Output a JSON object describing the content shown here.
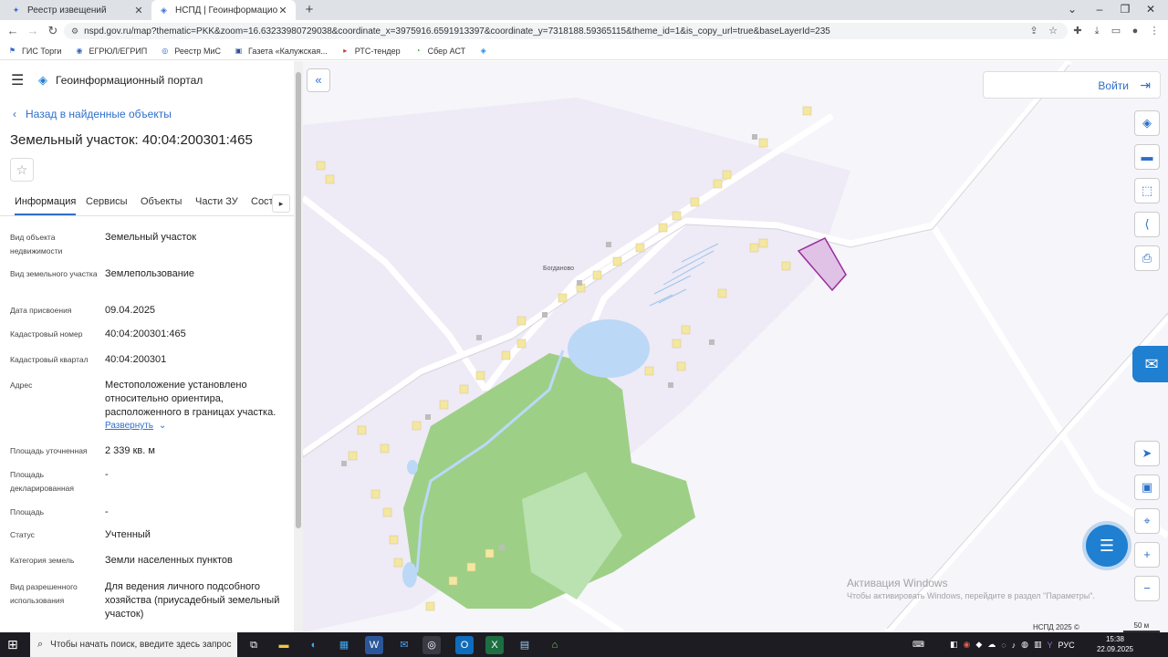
{
  "browser": {
    "tabs": [
      {
        "title": "Реестр извещений",
        "active": false
      },
      {
        "title": "НСПД | Геоинформационный п",
        "active": true
      }
    ],
    "url": "nspd.gov.ru/map?thematic=PKK&zoom=16.63233980729038&coordinate_x=3975916.6591913397&coordinate_y=7318188.59365115&theme_id=1&is_copy_url=true&baseLayerId=235",
    "bookmarks": [
      "ГИС Торги",
      "ЕГРЮЛ/ЕГРИП",
      "Реестр МиС",
      "Газета «Калужская...",
      "РТС-тендер",
      "Сбер АСТ"
    ]
  },
  "portal": {
    "title": "Геоинформационный портал",
    "back_link": "Назад в найденные объекты",
    "object_title": "Земельный участок: 40:04:200301:465"
  },
  "tabs": [
    "Информация",
    "Сервисы",
    "Объекты",
    "Части ЗУ",
    "Соста"
  ],
  "properties": [
    {
      "label": "Вид объекта недвижимости",
      "value": "Земельный участок"
    },
    {
      "label": "Вид земельного участка",
      "value": "Землепользование"
    },
    {
      "label": "Дата присвоения",
      "value": "09.04.2025"
    },
    {
      "label": "Кадастровый номер",
      "value": "40:04:200301:465"
    },
    {
      "label": "Кадастровый квартал",
      "value": "40:04:200301"
    },
    {
      "label": "Адрес",
      "value": "Местоположение установлено относительно ориентира, расположенного в границах участка."
    },
    {
      "label": "Площадь уточненная",
      "value": "2 339 кв. м"
    },
    {
      "label": "Площадь декларированная",
      "value": "-"
    },
    {
      "label": "Площадь",
      "value": "-"
    },
    {
      "label": "Статус",
      "value": "Учтенный"
    },
    {
      "label": "Категория земель",
      "value": "Земли населенных пунктов"
    },
    {
      "label": "Вид разрешенного использования",
      "value": "Для ведения личного подсобного хозяйства (приусадебный земельный участок)"
    }
  ],
  "expand_label": "Развернуть",
  "map": {
    "login_label": "Войти",
    "village_name": "Богданово",
    "watermark_title": "Активация Windows",
    "watermark_text": "Чтобы активировать Windows, перейдите в раздел \"Параметры\".",
    "footer_brand": "НСПД 2025 ©",
    "scale_label": "50 м",
    "colors": {
      "forest": "#9ecf86",
      "meadow": "#b9e2b0",
      "water": "#bcd8f7",
      "parcel": "#e0c2e6",
      "parcel_border": "#9b2c9b",
      "house": "#f3e7a2"
    }
  },
  "taskbar": {
    "search_placeholder": "Чтобы начать поиск, введите здесь запрос",
    "lang": "РУС",
    "time": "15:38",
    "date": "22.09.2025"
  }
}
